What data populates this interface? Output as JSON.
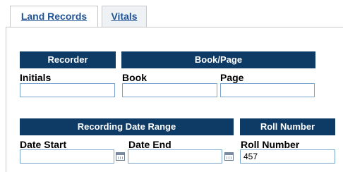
{
  "tabs": [
    {
      "label": "Land Records",
      "active": true
    },
    {
      "label": "Vitals",
      "active": false
    }
  ],
  "sections": {
    "recorder": {
      "header": "Recorder",
      "initials_label": "Initials",
      "initials_value": ""
    },
    "book_page": {
      "header": "Book/Page",
      "book_label": "Book",
      "book_value": "",
      "page_label": "Page",
      "page_value": ""
    },
    "date_range": {
      "header": "Recording Date Range",
      "start_label": "Date Start",
      "start_value": "",
      "end_label": "Date End",
      "end_value": ""
    },
    "roll_number": {
      "header": "Roll Number",
      "label": "Roll Number",
      "value": "457"
    }
  },
  "icons": {
    "calendar": "calendar-icon"
  },
  "colors": {
    "header_bg": "#0e3a66",
    "header_text": "#ffffff",
    "tab_link": "#1f5394",
    "input_border": "#7aa3cc"
  }
}
